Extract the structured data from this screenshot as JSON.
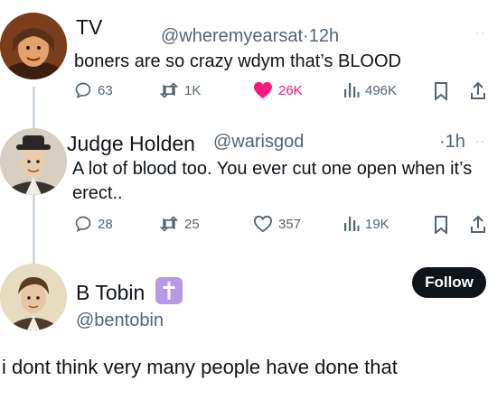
{
  "tweets": [
    {
      "name": "TV",
      "handle": "@wheremyearsat",
      "dot": "·",
      "time": "12h",
      "text": "boners are so crazy wdym that’s BLOOD",
      "replies": "63",
      "retweets": "1K",
      "likes": "26K",
      "liked": true,
      "views": "496K"
    },
    {
      "name": "Judge Holden",
      "handle": "@warisgod",
      "dot": "·",
      "time": "1h",
      "text": "A lot of blood too. You ever cut one open when it’s erect..",
      "replies": "28",
      "retweets": "25",
      "likes": "357",
      "liked": false,
      "views": "19K"
    }
  ],
  "main": {
    "name": "B Tobin",
    "badge_emoji": "✝️",
    "handle": "@bentobin",
    "follow_label": "Follow",
    "text": "i dont think very many people have done that"
  },
  "colors": {
    "text": "#0f1419",
    "muted": "#536471",
    "like_active": "#f91880",
    "thread_line": "#cfd9de"
  },
  "icons": [
    "reply-icon",
    "retweet-icon",
    "like-icon",
    "views-icon",
    "bookmark-icon",
    "share-icon",
    "more-icon"
  ]
}
